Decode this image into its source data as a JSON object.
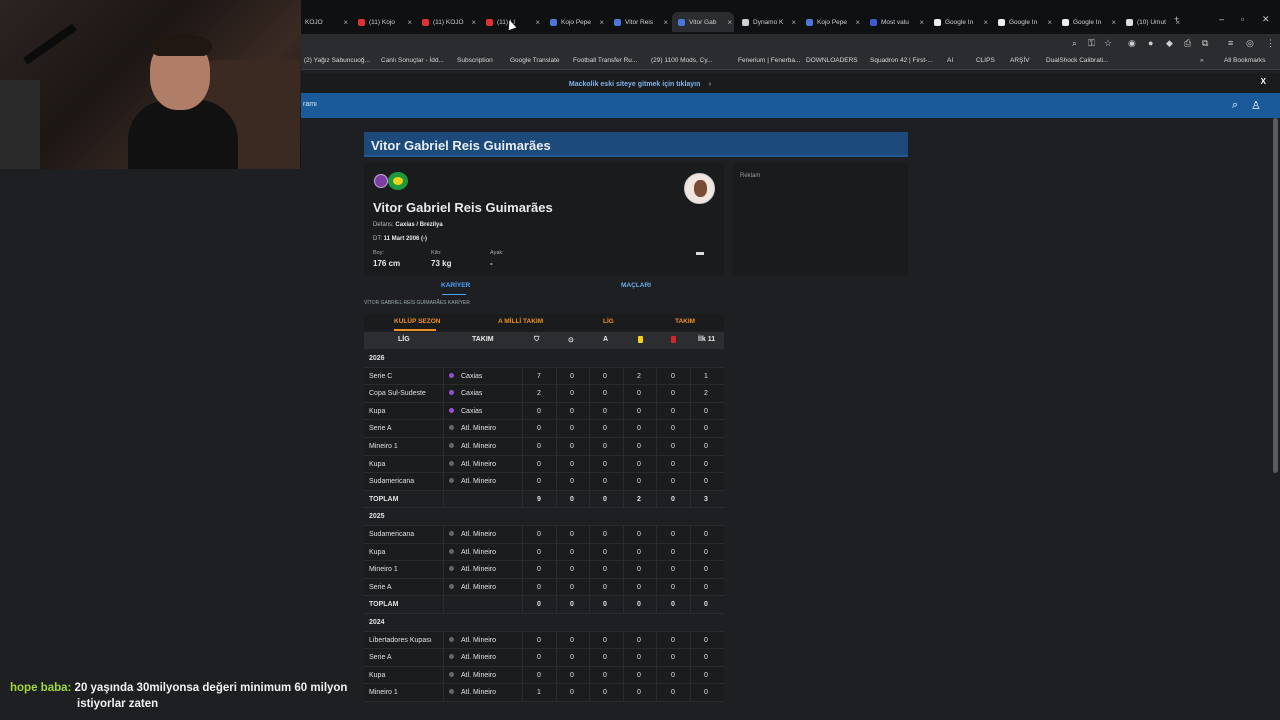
{
  "browser": {
    "tabs": [
      {
        "label": "KOJO"
      },
      {
        "label": "(11) Kojo"
      },
      {
        "label": "(11) KOJO"
      },
      {
        "label": "(11) Ll"
      },
      {
        "label": "Kojo Pepe"
      },
      {
        "label": "Vitor Reis"
      },
      {
        "label": "Vitor Gab"
      },
      {
        "label": "Dynamo K"
      },
      {
        "label": "Kojo Pepe"
      },
      {
        "label": "Most valu"
      },
      {
        "label": "Google In"
      },
      {
        "label": "Google In"
      },
      {
        "label": "Google In"
      },
      {
        "label": "(10) Umut"
      }
    ],
    "bookmarks": [
      {
        "label": "(2) Yağız Sabuncuoğ..."
      },
      {
        "label": "Canlı Sonuçlar - İdd..."
      },
      {
        "label": "Subscription"
      },
      {
        "label": "Google Translate"
      },
      {
        "label": "Football Transfer Ru..."
      },
      {
        "label": "(29) 1100 Mods, Cy..."
      },
      {
        "label": "Fenerium | Fenerba..."
      },
      {
        "label": "DOWNLOADERS"
      },
      {
        "label": "Squadron 42 | First-..."
      },
      {
        "label": "AI"
      },
      {
        "label": "CLIPS"
      },
      {
        "label": "ARŞİV"
      },
      {
        "label": "DualShock Calibrati..."
      },
      {
        "label": "All Bookmarks"
      }
    ]
  },
  "banner": {
    "link": "Mackolik eski siteye gitmek için tıklayın",
    "close": "X"
  },
  "navbar": {
    "text": "ramı"
  },
  "page": {
    "title": "Vitor Gabriel Reis Guimarães"
  },
  "player": {
    "name": "Vitor Gabriel Reis Guimarães",
    "position_label": "Defans:",
    "position_value": "Caxias / Brezilya",
    "birth_label": "DT:",
    "birth_value": "11 Mart 2006 (-)",
    "height_label": "Boy:",
    "height_value": "176 cm",
    "weight_label": "Kilo:",
    "weight_value": "73 kg",
    "foot_label": "Ayak:",
    "foot_value": "-"
  },
  "ad": {
    "label": "Reklam"
  },
  "profile_tabs": {
    "career": "KARİYER",
    "matches": "MAÇLARI"
  },
  "section_title": "VİTOR GABRİEL REİS GUİMARÃES KARİYER",
  "subtabs": {
    "club_season": "KULÜP SEZON",
    "national": "A MİLLİ TAKIM",
    "league": "LİG",
    "team": "TAKIM"
  },
  "table": {
    "headers": {
      "league": "LİG",
      "team": "TAKIM",
      "assists": "A",
      "first11": "İlk 11"
    },
    "rows": [
      {
        "type": "year",
        "label": "2026"
      },
      {
        "type": "data",
        "league": "Serie C",
        "team": "Caxias",
        "club": "caxias",
        "v": [
          "7",
          "0",
          "0",
          "2",
          "0",
          "1"
        ]
      },
      {
        "type": "data",
        "league": "Copa Sul-Sudeste",
        "team": "Caxias",
        "club": "caxias",
        "v": [
          "2",
          "0",
          "0",
          "0",
          "0",
          "2"
        ]
      },
      {
        "type": "data",
        "league": "Kupa",
        "team": "Caxias",
        "club": "caxias",
        "v": [
          "0",
          "0",
          "0",
          "0",
          "0",
          "0"
        ]
      },
      {
        "type": "data",
        "league": "Serie A",
        "team": "Atl. Mineiro",
        "club": "atl",
        "v": [
          "0",
          "0",
          "0",
          "0",
          "0",
          "0"
        ]
      },
      {
        "type": "data",
        "league": "Mineiro 1",
        "team": "Atl. Mineiro",
        "club": "atl",
        "v": [
          "0",
          "0",
          "0",
          "0",
          "0",
          "0"
        ]
      },
      {
        "type": "data",
        "league": "Kupa",
        "team": "Atl. Mineiro",
        "club": "atl",
        "v": [
          "0",
          "0",
          "0",
          "0",
          "0",
          "0"
        ]
      },
      {
        "type": "data",
        "league": "Sudamericana",
        "team": "Atl. Mineiro",
        "club": "atl",
        "v": [
          "0",
          "0",
          "0",
          "0",
          "0",
          "0"
        ]
      },
      {
        "type": "total",
        "league": "TOPLAM",
        "v": [
          "9",
          "0",
          "0",
          "2",
          "0",
          "3"
        ]
      },
      {
        "type": "year",
        "label": "2025"
      },
      {
        "type": "data",
        "league": "Sudamericana",
        "team": "Atl. Mineiro",
        "club": "atl",
        "v": [
          "0",
          "0",
          "0",
          "0",
          "0",
          "0"
        ]
      },
      {
        "type": "data",
        "league": "Kupa",
        "team": "Atl. Mineiro",
        "club": "atl",
        "v": [
          "0",
          "0",
          "0",
          "0",
          "0",
          "0"
        ]
      },
      {
        "type": "data",
        "league": "Mineiro 1",
        "team": "Atl. Mineiro",
        "club": "atl",
        "v": [
          "0",
          "0",
          "0",
          "0",
          "0",
          "0"
        ]
      },
      {
        "type": "data",
        "league": "Serie A",
        "team": "Atl. Mineiro",
        "club": "atl",
        "v": [
          "0",
          "0",
          "0",
          "0",
          "0",
          "0"
        ]
      },
      {
        "type": "total",
        "league": "TOPLAM",
        "v": [
          "0",
          "0",
          "0",
          "0",
          "0",
          "0"
        ]
      },
      {
        "type": "year",
        "label": "2024"
      },
      {
        "type": "data",
        "league": "Libertadores Kupası",
        "team": "Atl. Mineiro",
        "club": "atl",
        "v": [
          "0",
          "0",
          "0",
          "0",
          "0",
          "0"
        ]
      },
      {
        "type": "data",
        "league": "Serie A",
        "team": "Atl. Mineiro",
        "club": "atl",
        "v": [
          "0",
          "0",
          "0",
          "0",
          "0",
          "0"
        ]
      },
      {
        "type": "data",
        "league": "Kupa",
        "team": "Atl. Mineiro",
        "club": "atl",
        "v": [
          "0",
          "0",
          "0",
          "0",
          "0",
          "0"
        ]
      },
      {
        "type": "data",
        "league": "Mineiro 1",
        "team": "Atl. Mineiro",
        "club": "atl",
        "v": [
          "1",
          "0",
          "0",
          "0",
          "0",
          "0"
        ]
      }
    ]
  },
  "chat": {
    "name": "hope baba:",
    "message_line1": "20 yaşında 30milyonsa değeri minimum 60 milyon",
    "message_line2": "istiyorlar zaten"
  },
  "colors": {
    "accent_blue": "#1a5a9a",
    "title_bar": "#1c4a7a",
    "orange": "#f09020",
    "chat_name": "#9fd83a"
  }
}
